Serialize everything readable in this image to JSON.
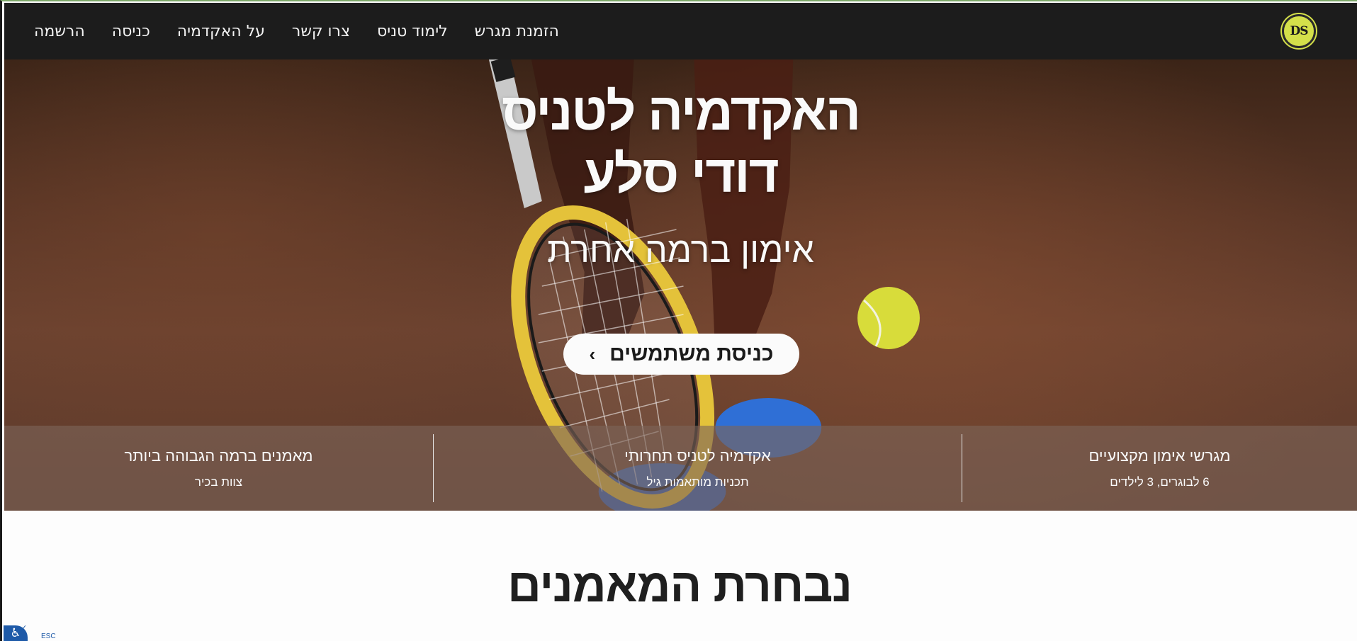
{
  "nav": {
    "logo_text": "DS",
    "links": [
      "הזמנת מגרש",
      "לימוד טניס",
      "צרו קשר",
      "על האקדמיה",
      "כניסה",
      "הרשמה"
    ]
  },
  "hero": {
    "title_line1": "האקדמיה לטניס",
    "title_line2": "דודי סלע",
    "subtitle": "אימון ברמה אחרת",
    "cta_label": "כניסת משתמשים",
    "cta_arrow": "›"
  },
  "features": [
    {
      "title": "מגרשי אימון מקצועיים",
      "subtitle": "6 לבוגרים, 3 לילדים"
    },
    {
      "title": "אקדמיה לטניס תחרותי",
      "subtitle": "תכניות מותאמות גיל"
    },
    {
      "title": "מאמנים ברמה הגבוהה ביותר",
      "subtitle": "צוות בכיר"
    }
  ],
  "section": {
    "heading": "נבחרת המאמנים"
  },
  "accessibility": {
    "icon": "wheelchair-icon",
    "esc_label": "ESC"
  },
  "colors": {
    "navbar": "#1c1c1c",
    "logo": "#d4e04a",
    "clay": "#6b4230",
    "ball": "#d8dc3a",
    "accent_blue": "#1e5aa8"
  }
}
